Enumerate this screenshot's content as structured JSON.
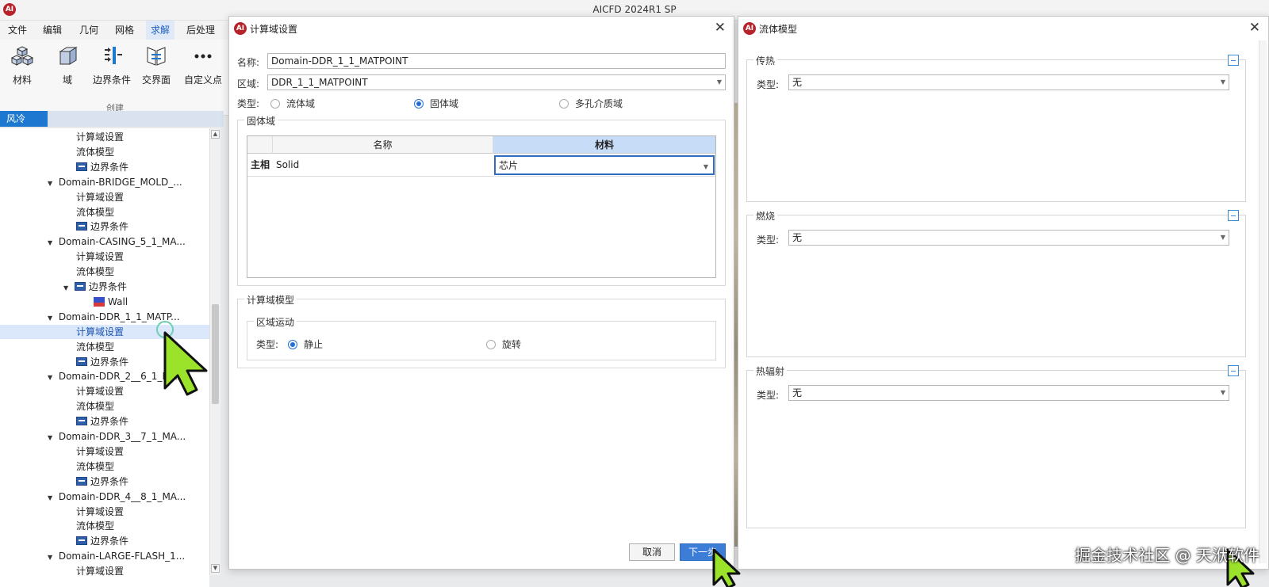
{
  "window": {
    "title": "AICFD 2024R1 SP",
    "logo": "AI"
  },
  "menubar": {
    "items": [
      "文件",
      "编辑",
      "几何",
      "网格",
      "求解",
      "后处理"
    ],
    "active_index": 4
  },
  "ribbon": {
    "buttons": [
      {
        "label": "材料",
        "icon": "materials-icon"
      },
      {
        "label": "域",
        "icon": "domain-box-icon"
      },
      {
        "label": "边界条件",
        "icon": "boundary-condition-icon"
      },
      {
        "label": "交界面",
        "icon": "interface-icon"
      },
      {
        "label": "自定义点",
        "icon": "more-dots-icon"
      }
    ],
    "group_label": "创建"
  },
  "case_tab": "风冷",
  "tree": {
    "rows": [
      {
        "text": "计算域设置",
        "level": 2
      },
      {
        "text": "流体模型",
        "level": 2
      },
      {
        "text": "边界条件",
        "level": 2,
        "icon": "bc"
      },
      {
        "text": "Domain-BRIDGE_MOLD_...",
        "level": 1,
        "expanded": true
      },
      {
        "text": "计算域设置",
        "level": 2
      },
      {
        "text": "流体模型",
        "level": 2
      },
      {
        "text": "边界条件",
        "level": 2,
        "icon": "bc"
      },
      {
        "text": "Domain-CASING_5_1_MA...",
        "level": 1,
        "expanded": true
      },
      {
        "text": "计算域设置",
        "level": 2
      },
      {
        "text": "流体模型",
        "level": 2
      },
      {
        "text": "边界条件",
        "level": 2,
        "icon": "bc",
        "expanded": true
      },
      {
        "text": "Wall",
        "level": 3,
        "icon": "wall"
      },
      {
        "text": "Domain-DDR_1_1_MATP...",
        "level": 1,
        "expanded": true
      },
      {
        "text": "计算域设置",
        "level": 2,
        "selected": true
      },
      {
        "text": "流体模型",
        "level": 2
      },
      {
        "text": "边界条件",
        "level": 2,
        "icon": "bc"
      },
      {
        "text": "Domain-DDR_2__6_1_MA...",
        "level": 1,
        "expanded": true
      },
      {
        "text": "计算域设置",
        "level": 2
      },
      {
        "text": "流体模型",
        "level": 2
      },
      {
        "text": "边界条件",
        "level": 2,
        "icon": "bc"
      },
      {
        "text": "Domain-DDR_3__7_1_MA...",
        "level": 1,
        "expanded": true
      },
      {
        "text": "计算域设置",
        "level": 2
      },
      {
        "text": "流体模型",
        "level": 2
      },
      {
        "text": "边界条件",
        "level": 2,
        "icon": "bc"
      },
      {
        "text": "Domain-DDR_4__8_1_MA...",
        "level": 1,
        "expanded": true
      },
      {
        "text": "计算域设置",
        "level": 2
      },
      {
        "text": "流体模型",
        "level": 2
      },
      {
        "text": "边界条件",
        "level": 2,
        "icon": "bc"
      },
      {
        "text": "Domain-LARGE-FLASH_1...",
        "level": 1,
        "expanded": true
      },
      {
        "text": "计算域设置",
        "level": 2
      }
    ]
  },
  "domain_dialog": {
    "title": "计算域设置",
    "name_label": "名称:",
    "name_value": "Domain-DDR_1_1_MATPOINT",
    "region_label": "区域:",
    "region_value": "DDR_1_1_MATPOINT",
    "type_label": "类型:",
    "type_options": [
      "流体域",
      "固体域",
      "多孔介质域"
    ],
    "type_selected": 1,
    "solid_group_title": "固体域",
    "grid": {
      "headers": [
        "名称",
        "材料"
      ],
      "row_header": "主相",
      "row_name": "Solid",
      "row_material": "芯片"
    },
    "model_group_title": "计算域模型",
    "motion_group_title": "区域运动",
    "motion_type_label": "类型:",
    "motion_options": [
      "静止",
      "旋转"
    ],
    "motion_selected": 0,
    "cancel_label": "取消",
    "next_label": "下一步"
  },
  "fluid_dialog": {
    "title": "流体模型",
    "panels": [
      {
        "title": "传热",
        "type_label": "类型:",
        "value": "无"
      },
      {
        "title": "燃烧",
        "type_label": "类型:",
        "value": "无"
      },
      {
        "title": "热辐射",
        "type_label": "类型:",
        "value": "无"
      }
    ]
  },
  "watermark": "掘金技术社区 @ 天洑软件",
  "colors": {
    "accent": "#1e78d0",
    "brand": "#b8222a",
    "cursor": "#9be22a"
  }
}
